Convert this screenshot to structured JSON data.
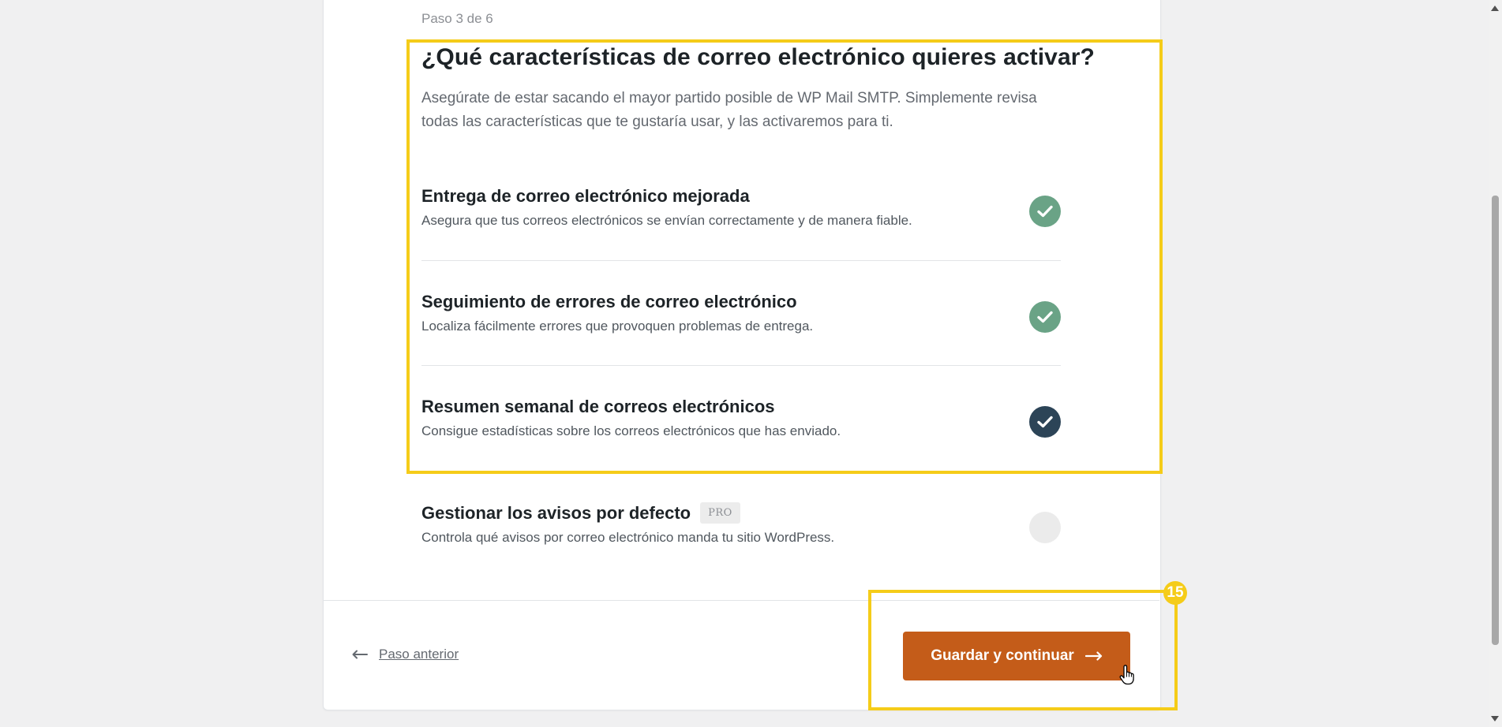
{
  "step_label": "Paso 3 de 6",
  "heading": "¿Qué características de correo electrónico quieres activar?",
  "lead": "Asegúrate de estar sacando el mayor partido posible de WP Mail SMTP. Simplemente revisa todas las características que te gustaría usar, y las activaremos para ti.",
  "features": [
    {
      "title": "Entrega de correo electrónico mejorada",
      "description": "Asegura que tus correos electrónicos se envían correctamente y de manera fiable.",
      "checked": true,
      "check_color": "#6aa386"
    },
    {
      "title": "Seguimiento de errores de correo electrónico",
      "description": "Localiza fácilmente errores que provoquen problemas de entrega.",
      "checked": true,
      "check_color": "#6aa386"
    },
    {
      "title": "Resumen semanal de correos electrónicos",
      "description": "Consigue estadísticas sobre los correos electrónicos que has enviado.",
      "checked": true,
      "check_color": "#2c4457"
    },
    {
      "title": "Gestionar los avisos por defecto",
      "badge": "PRO",
      "description": "Controla qué avisos por correo electrónico manda tu sitio WordPress.",
      "checked": false
    }
  ],
  "footer": {
    "prev_label": "Paso anterior",
    "prev_icon": "arrow-left-icon",
    "save_label": "Guardar y continuar",
    "save_icon": "arrow-right-icon",
    "accent_color": "#c45c19"
  },
  "annotation": {
    "number": "15",
    "color": "#f5cc19"
  }
}
